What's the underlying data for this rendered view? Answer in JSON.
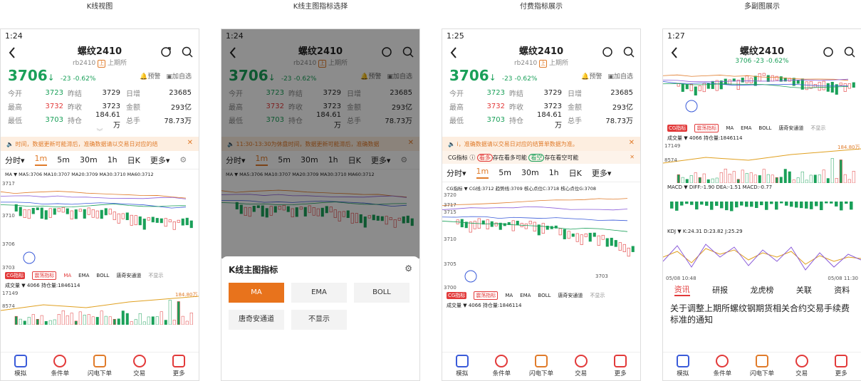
{
  "captions": [
    "K线视图",
    "K线主图指标选择",
    "付费指标展示",
    "多副图展示"
  ],
  "common": {
    "name": "螺纹2410",
    "code": "rb2410",
    "exchange_tag": "上",
    "exchange": "上期所",
    "price": "3706",
    "arrow": "↓",
    "change": "-23",
    "change_pct": "-0.62%",
    "alert": "预警",
    "watch": "加自选",
    "stats": [
      {
        "l": "今开",
        "v": "3723",
        "l2": "昨结",
        "v2": "3729",
        "l3": "日增",
        "v3": "23685"
      },
      {
        "l": "最高",
        "v": "3732",
        "l2": "昨收",
        "v2": "3723",
        "l3": "金额",
        "v3": "293亿"
      },
      {
        "l": "最低",
        "v": "3703",
        "l2": "持仓",
        "v2": "184.61万",
        "l3": "总手",
        "v3": "78.73万"
      }
    ],
    "tabs": [
      "分时",
      "1m",
      "5m",
      "30m",
      "1h",
      "日K",
      "更多"
    ],
    "nav": [
      "模拟",
      "条件单",
      "闪电下单",
      "交易",
      "更多"
    ],
    "volume_legend": "成交量 ▼ 4066 持仓量:1846114",
    "vol_top": "17149",
    "vol_mid": "8574",
    "vol_flag": "184.80万"
  },
  "screens": [
    {
      "time": "1:24",
      "notice": "时间，数据更新可能滞后，准确数据请以交易日对应的结",
      "ma_legend": "MA ▼ MA5:3706 MA10:3707 MA20:3709 MA30:3710 MA60:3712",
      "yticks": [
        "3717",
        "3710",
        "3706",
        "3703"
      ],
      "indicators": [
        "CG指标",
        "震荡指标",
        "MA",
        "EMA",
        "BOLL",
        "唐奇安通道",
        "不显示"
      ]
    },
    {
      "time": "1:24",
      "notice": "11:30-13:30为休盘时间，数据更新可能滞后，准确数据",
      "ma_legend": "MA ▼ MA5:3706 MA10:3707 MA20:3709 MA30:3710 MA60:3712",
      "sheet_title": "K线主图指标",
      "options": [
        "MA",
        "EMA",
        "BOLL",
        "唐奇安通道",
        "不显示"
      ]
    },
    {
      "time": "1:25",
      "notice": "i，准确数据请以交易日对应的结算单数据为准。",
      "cg_row": {
        "label": "CG指标",
        "a": "看多",
        "a_text": "存在看多可能",
        "b": "看空",
        "b_text": "存在看空可能"
      },
      "ma_legend": "CG指标 ▼ CG线:3712 趋势线:3709 核心点位C:3718 核心点位G:3708",
      "yticks": [
        "3720",
        "3717",
        "3715",
        "3710",
        "3705",
        "3703",
        "3700"
      ],
      "indicators": [
        "CG指标",
        "震荡指标",
        "MA",
        "EMA",
        "BOLL",
        "唐奇安通道",
        "不显示"
      ]
    },
    {
      "time": "1:27",
      "indicators": [
        "CG指标",
        "震荡指标",
        "MA",
        "EMA",
        "BOLL",
        "唐奇安通道",
        "不显示"
      ],
      "macd": "MACD ▼ DIFF:-1.90 DEA:-1.51 MACD:-0.77",
      "kdj": "KDJ ▼ K:24.31 D:23.82 J:25.29",
      "time_start": "05/08 10:48",
      "time_end": "05/08 11:30",
      "news_tabs": [
        "资讯",
        "研报",
        "龙虎榜",
        "关联",
        "资料"
      ],
      "news": "关于调整上期所螺纹钢期货相关合约交易手续费标准的通知"
    }
  ]
}
